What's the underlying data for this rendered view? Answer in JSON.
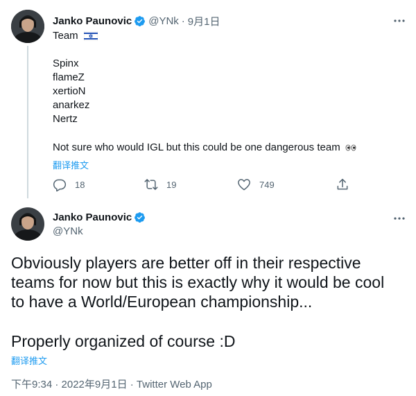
{
  "tweet_parent": {
    "author": {
      "display_name": "Janko Paunovic",
      "handle": "@YNk",
      "date": "9月1日",
      "dot": "·"
    },
    "text": {
      "line1": "Team",
      "players": [
        "Spinx",
        "flameZ",
        "xertioN",
        "anarkez",
        "Nertz"
      ],
      "closing": "Not sure who would IGL but this could be one dangerous team"
    },
    "translate_label": "翻译推文",
    "stats": {
      "replies": "18",
      "retweets": "19",
      "likes": "749"
    },
    "flag_icon": "israel-flag-icon",
    "emoji_icon": "eyes-emoji-icon"
  },
  "tweet_focused": {
    "author": {
      "display_name": "Janko Paunovic",
      "handle": "@YNk"
    },
    "text": {
      "lines": [
        "Obviously players are better off in their respective",
        "teams for now but this is exactly why it would be cool",
        "to have a World/European championship..."
      ],
      "last_line": "Properly organized of course :D"
    },
    "translate_label": "翻译推文",
    "meta": "下午9:34 · 2022年9月1日 · Twitter Web App"
  },
  "colors": {
    "text": "#0f1419",
    "secondary": "#536471",
    "accent": "#1d9bf0",
    "thread_line": "#cfd9de"
  }
}
